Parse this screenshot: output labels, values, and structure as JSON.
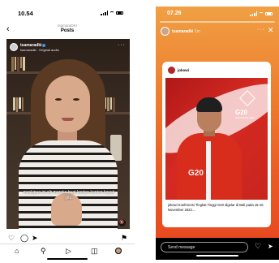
{
  "left_phone": {
    "status_time": "10.54",
    "header": {
      "username": "tsamaraDKI",
      "title": "Posts"
    },
    "post": {
      "username": "tsamaradki",
      "audio": "tsamaradki · Original audio",
      "subtitle": "meskipun ini sih mereka buat konten-konten bayek gitu."
    },
    "icons": {
      "back": "back-icon",
      "like": "heart-icon",
      "comment": "comment-icon",
      "share": "share-icon",
      "save": "bookmark-icon",
      "home": "home-icon",
      "search": "search-icon",
      "reels": "reels-icon",
      "shop": "shop-icon"
    }
  },
  "right_phone": {
    "status_time": "07.26",
    "story": {
      "username": "tsamaradki",
      "time": "1m"
    },
    "embed": {
      "username": "jokowi",
      "caption": "jokowi Konferensi Tingkat Tinggi G20 digelar di Bali pada 15-16 November 2022....",
      "g20_label": "G20",
      "g20_sub": "INDONESIA 2022"
    },
    "send_bar": {
      "placeholder": "Send message"
    }
  },
  "colors": {
    "story_gradient_top": "#f0a044",
    "story_gradient_bottom": "#e84a20",
    "g20_red": "#d42a22",
    "verified_blue": "#3897f0"
  }
}
